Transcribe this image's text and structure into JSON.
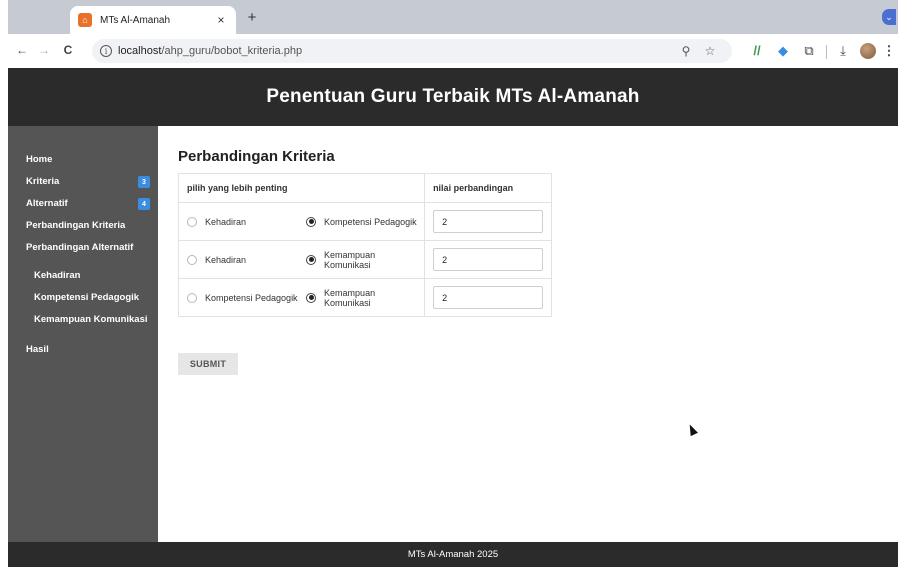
{
  "browser": {
    "tab_title": "MTs Al-Amanah",
    "tab_close": "×",
    "new_tab": "+",
    "favicon_glyph": "⌂",
    "url_host": "localhost",
    "url_path": "/ahp_guru/bobot_kriteria.php",
    "icons": {
      "back": "←",
      "forward": "→",
      "reload": "C",
      "info": "i",
      "zoom": "⚲",
      "bookmark": "☆",
      "ext1": "//",
      "ext2": "◆",
      "extensions": "⧉",
      "download": "⤓",
      "menu": "⋮",
      "tab_menu": "⌄"
    }
  },
  "header": {
    "title": "Penentuan Guru Terbaik MTs Al-Amanah"
  },
  "sidebar": {
    "items": [
      {
        "label": "Home"
      },
      {
        "label": "Kriteria",
        "badge": "3"
      },
      {
        "label": "Alternatif",
        "badge": "4"
      },
      {
        "label": "Perbandingan Kriteria"
      },
      {
        "label": "Perbandingan Alternatif"
      },
      {
        "label": "Kehadiran"
      },
      {
        "label": "Kompetensi Pedagogik"
      },
      {
        "label": "Kemampuan Komunikasi"
      },
      {
        "label": "Hasil"
      }
    ]
  },
  "main": {
    "title": "Perbandingan Kriteria",
    "table": {
      "headers": [
        "pilih yang lebih penting",
        "nilai perbandingan"
      ],
      "rows": [
        {
          "option_a": "Kehadiran",
          "option_b": "Kompetensi Pedagogik",
          "selected": "b",
          "value": "2"
        },
        {
          "option_a": "Kehadiran",
          "option_b": "Kemampuan Komunikasi",
          "selected": "b",
          "value": "2"
        },
        {
          "option_a": "Kompetensi Pedagogik",
          "option_b": "Kemampuan Komunikasi",
          "selected": "b",
          "value": "2"
        }
      ]
    },
    "submit_label": "SUBMIT"
  },
  "footer": {
    "text": "MTs Al-Amanah 2025"
  },
  "colors": {
    "header_bg": "#2b2b2b",
    "sidebar_bg": "#555555",
    "badge": "#3a8de0",
    "favicon": "#e8702a"
  }
}
